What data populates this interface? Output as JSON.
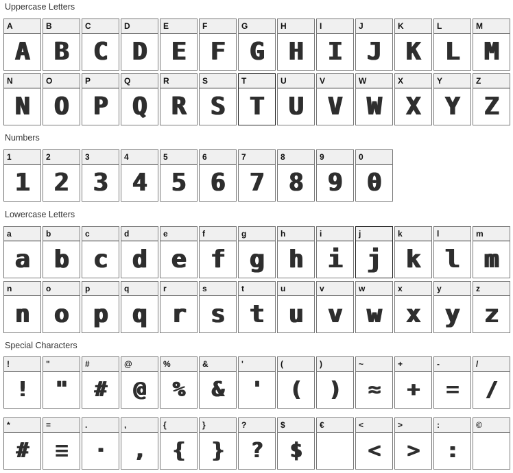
{
  "sections": [
    {
      "title": "Uppercase Letters",
      "rows": [
        [
          "A",
          "B",
          "C",
          "D",
          "E",
          "F",
          "G",
          "H",
          "I",
          "J",
          "K",
          "L",
          "M"
        ],
        [
          "N",
          "O",
          "P",
          "Q",
          "R",
          "S",
          "T",
          "U",
          "V",
          "W",
          "X",
          "Y",
          "Z"
        ]
      ],
      "glyphs": [
        [
          "A",
          "B",
          "C",
          "D",
          "E",
          "F",
          "G",
          "H",
          "I",
          "J",
          "K",
          "L",
          "M"
        ],
        [
          "N",
          "O",
          "P",
          "Q",
          "R",
          "S",
          "T",
          "U",
          "V",
          "W",
          "X",
          "Y",
          "Z"
        ]
      ]
    },
    {
      "title": "Numbers",
      "rows": [
        [
          "1",
          "2",
          "3",
          "4",
          "5",
          "6",
          "7",
          "8",
          "9",
          "0"
        ]
      ],
      "glyphs": [
        [
          "1",
          "2",
          "3",
          "4",
          "5",
          "6",
          "7",
          "8",
          "9",
          "0"
        ]
      ]
    },
    {
      "title": "Lowercase Letters",
      "rows": [
        [
          "a",
          "b",
          "c",
          "d",
          "e",
          "f",
          "g",
          "h",
          "i",
          "j",
          "k",
          "l",
          "m"
        ],
        [
          "n",
          "o",
          "p",
          "q",
          "r",
          "s",
          "t",
          "u",
          "v",
          "w",
          "x",
          "y",
          "z"
        ]
      ],
      "glyphs": [
        [
          "a",
          "b",
          "c",
          "d",
          "e",
          "f",
          "g",
          "h",
          "i",
          "j",
          "k",
          "l",
          "m"
        ],
        [
          "n",
          "o",
          "p",
          "q",
          "r",
          "s",
          "t",
          "u",
          "v",
          "w",
          "x",
          "y",
          "z"
        ]
      ]
    },
    {
      "title": "Special Characters",
      "rows": [
        [
          "!",
          "\"",
          "#",
          "@",
          "%",
          "&",
          "'",
          "(",
          ")",
          "~",
          "+",
          "-",
          "/"
        ],
        [
          "*",
          "=",
          ".",
          ",",
          "{",
          "}",
          "?",
          "$",
          "€",
          "<",
          ">",
          ":",
          "©"
        ]
      ],
      "glyphs": [
        [
          "!",
          "\"",
          "#",
          "@",
          "%",
          "&",
          "'",
          "(",
          ")",
          "≈",
          "+",
          "=",
          "/"
        ],
        [
          "#",
          "≡",
          "·",
          ",",
          "{",
          "}",
          "?",
          "$",
          "",
          "<",
          ">",
          ":",
          ""
        ]
      ]
    }
  ]
}
